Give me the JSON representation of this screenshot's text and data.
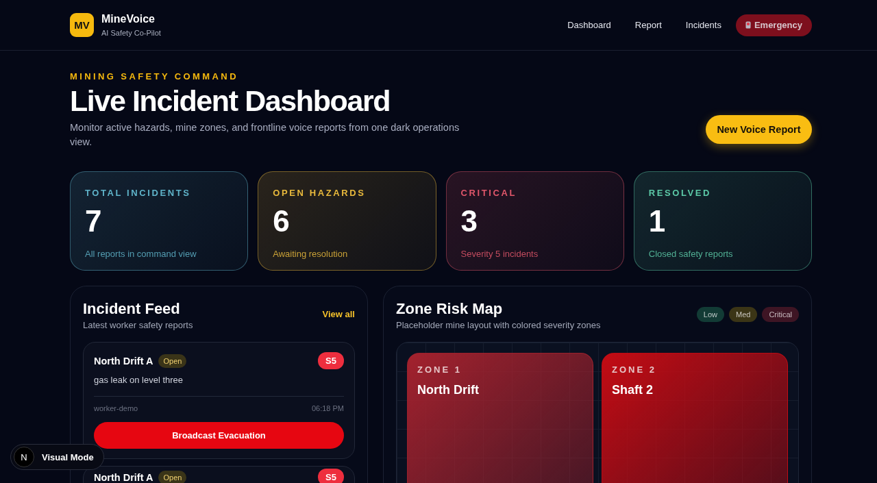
{
  "brand": {
    "logo": "MV",
    "name": "MineVoice",
    "tagline": "AI Safety Co-Pilot"
  },
  "nav": [
    {
      "label": "Dashboard",
      "kind": "link"
    },
    {
      "label": "Report",
      "kind": "link"
    },
    {
      "label": "Incidents",
      "kind": "link"
    },
    {
      "label": "Emergency",
      "kind": "emergency"
    }
  ],
  "hero": {
    "eyebrow": "MINING SAFETY COMMAND",
    "title": "Live Incident Dashboard",
    "description": "Monitor active hazards, mine zones, and frontline voice reports from one dark operations view.",
    "action": "New Voice Report"
  },
  "stats": [
    {
      "label": "TOTAL INCIDENTS",
      "value": "7",
      "caption": "All reports in command view",
      "color": "#5fb3c9"
    },
    {
      "label": "OPEN HAZARDS",
      "value": "6",
      "caption": "Awaiting resolution",
      "color": "#e8b93c"
    },
    {
      "label": "CRITICAL",
      "value": "3",
      "caption": "Severity 5 incidents",
      "color": "#e0566a"
    },
    {
      "label": "RESOLVED",
      "value": "1",
      "caption": "Closed safety reports",
      "color": "#5cc9a7"
    }
  ],
  "feed": {
    "title": "Incident Feed",
    "subtitle": "Latest worker safety reports",
    "link": "View all",
    "incidents": [
      {
        "location": "North Drift A",
        "status": "Open",
        "severity": "S5",
        "description": "gas leak on level three",
        "reporter": "worker-demo",
        "time": "06:18 PM",
        "action": "Broadcast Evacuation"
      },
      {
        "location": "North Drift A",
        "status": "Open",
        "severity": "S5"
      }
    ]
  },
  "map": {
    "title": "Zone Risk Map",
    "subtitle": "Placeholder mine layout with colored severity zones",
    "legend": [
      {
        "label": "Low",
        "color": "#123b35"
      },
      {
        "label": "Med",
        "color": "#3b3516"
      },
      {
        "label": "Critical",
        "color": "#3e1524"
      }
    ],
    "zones": [
      {
        "label": "ZONE 1",
        "name": "North Drift",
        "color": "#a3222e"
      },
      {
        "label": "ZONE 2",
        "name": "Shaft 2",
        "color": "#c40c14"
      }
    ]
  },
  "visual_mode": {
    "logo": "N",
    "label": "Visual Mode"
  }
}
